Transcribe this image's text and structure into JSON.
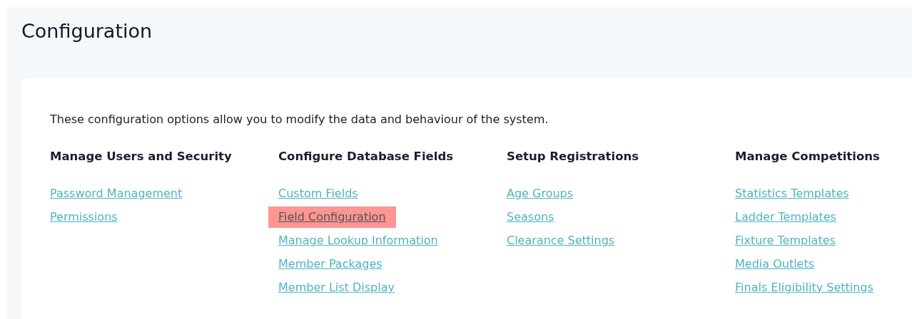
{
  "page": {
    "title": "Configuration"
  },
  "intro": "These configuration options allow you to modify the data and behaviour of the system.",
  "sections": [
    {
      "heading": "Manage Users and Security",
      "links": [
        {
          "label": "Password Management",
          "highlighted": false
        },
        {
          "label": "Permissions",
          "highlighted": false
        }
      ]
    },
    {
      "heading": "Configure Database Fields",
      "links": [
        {
          "label": "Custom Fields",
          "highlighted": false
        },
        {
          "label": "Field Configuration",
          "highlighted": true
        },
        {
          "label": "Manage Lookup Information",
          "highlighted": false
        },
        {
          "label": "Member Packages",
          "highlighted": false
        },
        {
          "label": "Member List Display",
          "highlighted": false
        }
      ]
    },
    {
      "heading": "Setup Registrations",
      "links": [
        {
          "label": "Age Groups",
          "highlighted": false
        },
        {
          "label": "Seasons",
          "highlighted": false
        },
        {
          "label": "Clearance Settings",
          "highlighted": false
        }
      ]
    },
    {
      "heading": "Manage Competitions",
      "links": [
        {
          "label": "Statistics Templates",
          "highlighted": false
        },
        {
          "label": "Ladder Templates",
          "highlighted": false
        },
        {
          "label": "Fixture Templates",
          "highlighted": false
        },
        {
          "label": "Media Outlets",
          "highlighted": false
        },
        {
          "label": "Finals Eligibility Settings",
          "highlighted": false
        }
      ]
    }
  ]
}
